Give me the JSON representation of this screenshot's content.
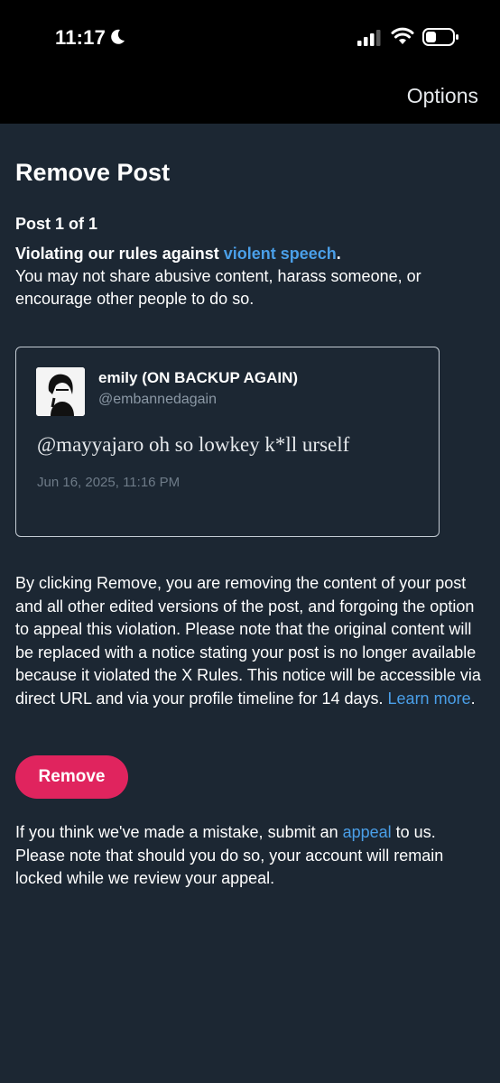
{
  "status_bar": {
    "time": "11:17",
    "icons": [
      "moon-icon",
      "signal-icon",
      "wifi-icon",
      "battery-icon"
    ]
  },
  "header": {
    "options_label": "Options"
  },
  "page": {
    "title": "Remove Post",
    "post_count": "Post 1 of 1",
    "violation_prefix": "Violating our rules against ",
    "violation_link": "violent speech",
    "violation_suffix": ".",
    "violation_desc": "You may not share abusive content, harass someone, or encourage other people to do so."
  },
  "post": {
    "author_name": "emily (ON BACKUP AGAIN)",
    "author_handle": "@embannedagain",
    "text": "@mayyajaro oh so lowkey k*ll urself",
    "timestamp": "Jun 16, 2025, 11:16 PM"
  },
  "disclaimer": {
    "body": "By clicking Remove, you are removing the content of your post and all other edited versions of the post, and forgoing the option to appeal this violation. Please note that the original content will be replaced with a notice stating your post is no longer available because it violated the X Rules. This notice will be accessible via direct URL and via your profile timeline for 14 days. ",
    "learn_more": "Learn more",
    "end": "."
  },
  "actions": {
    "remove_label": "Remove"
  },
  "appeal": {
    "prefix": "If you think we've made a mistake, submit an ",
    "link": "appeal",
    "suffix": " to us. Please note that should you do so, your account will remain locked while we review your appeal."
  },
  "colors": {
    "background": "#1c2733",
    "link": "#4a9fe8",
    "remove_button": "#e0245e"
  }
}
